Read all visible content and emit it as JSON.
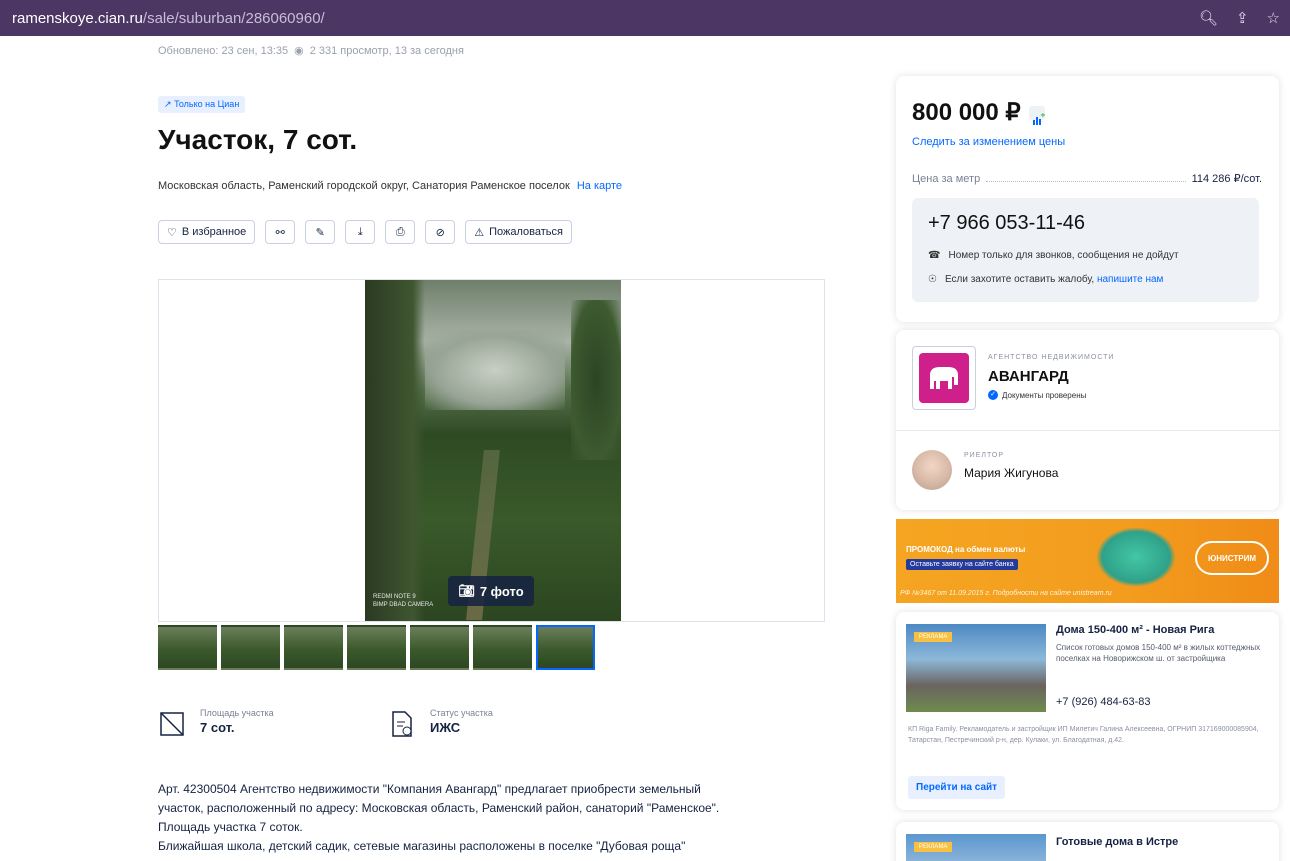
{
  "browser": {
    "url_host": "ramenskoye.cian.ru",
    "url_path": "/sale/suburban/286060960/"
  },
  "meta": {
    "updated": "Обновлено: 23 сен, 13:35",
    "views": "2 331 просмотр, 13 за сегодня"
  },
  "listing": {
    "badge": "Только на Циан",
    "title": "Участок, 7 сот.",
    "address": "Московская область, Раменский городской округ, Санатория Раменское поселок",
    "map_link": "На карте"
  },
  "actions": {
    "favorite": "В избранное",
    "report": "Пожаловаться"
  },
  "gallery": {
    "photos_label": "7 фото",
    "watermark": "REDMI NOTE 9\nBIMP DBAD CAMERA",
    "thumbnail_count": 7
  },
  "specs": [
    {
      "label": "Площадь участка",
      "value": "7 сот."
    },
    {
      "label": "Статус участка",
      "value": "ИЖС"
    }
  ],
  "description": [
    "Арт. 42300504 Агентство недвижимости \"Компания Авангард\" предлагает приобрести земельный",
    "участок, расположенный по адресу: Московская область, Раменский район, санаторий \"Раменское\".",
    "Площадь участка 7 соток.",
    "Ближайшая школа, детский садик, сетевые магазины расположены в поселке \"Дубовая роща\""
  ],
  "price_card": {
    "price": "800 000 ₽",
    "follow": "Следить за изменением цены",
    "per_meter_label": "Цена за метр",
    "per_meter_value": "114 286 ₽/сот.",
    "phone": "+7 966 053-11-46",
    "note_calls": "Номер только для звонков, сообщения не дойдут",
    "note_complaint": "Если захотите оставить жалобу,",
    "note_link": "напишите нам"
  },
  "agent": {
    "type": "АГЕНТСТВО НЕДВИЖИМОСТИ",
    "name": "АВАНГАРД",
    "docs": "Документы проверены",
    "realtor_role": "РИЕЛТОР",
    "realtor_name": "Мария Жигунова"
  },
  "promo": {
    "line1": "ПРОМОКОД на обмен валюты",
    "line2": "Оставьте заявку на сайте банка",
    "legal": "РФ №3467 от 11.09.2015 г. Подробности на сайте unistream.ru",
    "brand": "ЮНИСТРИМ"
  },
  "ad1": {
    "tag": "РЕКЛАМА",
    "title": "Дома 150-400 м² - Новая Рига",
    "text": "Список готовых домов 150-400 м² в жилых коттеджных поселках на Новорижском ш. от застройщика",
    "phone": "+7 (926) 484-63-83",
    "legal": "КП Riga Family. Рекламодатель и застройщик ИП Милетич Галина Алексеевна, ОГРНИП 317169000085904, Татарстан, Пестречинский р-н, дер. Кулаки, ул. Благодатная, д.42.",
    "button": "Перейти на сайт"
  },
  "ad2": {
    "tag": "РЕКЛАМА",
    "title": "Готовые дома в Истре"
  },
  "colors": {
    "accent": "#0468ff",
    "urlbar": "#4b3664",
    "promo": "#f5a521",
    "brand_pink": "#cf1f8a"
  }
}
